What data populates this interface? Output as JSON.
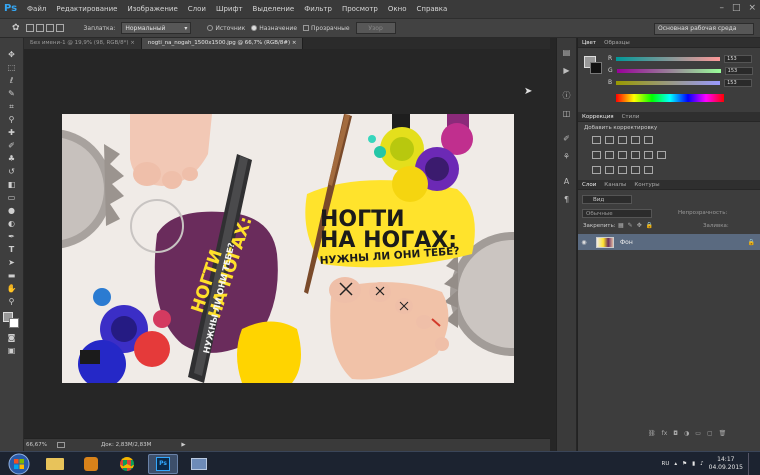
{
  "app": {
    "logo": "Ps"
  },
  "menu": [
    "Файл",
    "Редактирование",
    "Изображение",
    "Слои",
    "Шрифт",
    "Выделение",
    "Фильтр",
    "Просмотр",
    "Окно",
    "Справка"
  ],
  "options": {
    "feather_label": "Заплатка:",
    "mode_value": "Нормальный",
    "source_label": "Источник",
    "destination_label": "Назначение",
    "transparent_label": "Прозрачные",
    "pattern_label": "Узор",
    "workspace_value": "Основная рабочая среда"
  },
  "tabs": [
    {
      "label": "Без имени-1 @ 19,9% (98, RGB/8*) ×"
    },
    {
      "label": "nogti_na_nogah_1500x1500.jpg @ 66,7% (RGB/8#) ×"
    }
  ],
  "artwork": {
    "headline_line1": "НОГТИ",
    "headline_line2": "НА НОГАХ:",
    "subtitle": "НУЖНЫ ЛИ ОНИ ТЕБЕ?",
    "vertical_line1": "НОГТИ",
    "vertical_line2": "НА НОГАХ:",
    "file_text": "НУЖНЫ ЛИ ОНИ ТЕБЕ?"
  },
  "status": {
    "zoom": "66,67%",
    "doc": "Док: 2,83M/2,83M"
  },
  "color_panel": {
    "tabs": [
      "Цвет",
      "Образцы"
    ],
    "channels": [
      {
        "label": "R",
        "value": "153"
      },
      {
        "label": "G",
        "value": "153"
      },
      {
        "label": "B",
        "value": "153"
      }
    ]
  },
  "adjustments_panel": {
    "tabs": [
      "Коррекция",
      "Стили"
    ],
    "add_label": "Добавить корректировку"
  },
  "layers_panel": {
    "tabs": [
      "Слои",
      "Каналы",
      "Контуры"
    ],
    "kind_label": "Вид",
    "blend_mode": "Обычные",
    "opacity_label": "Непрозрачность:",
    "lock_label": "Закрепить:",
    "fill_label": "Заливка:",
    "layer_name": "Фон"
  },
  "taskbar": {
    "lang": "RU",
    "time": "14:17",
    "date": "04.09.2015"
  }
}
